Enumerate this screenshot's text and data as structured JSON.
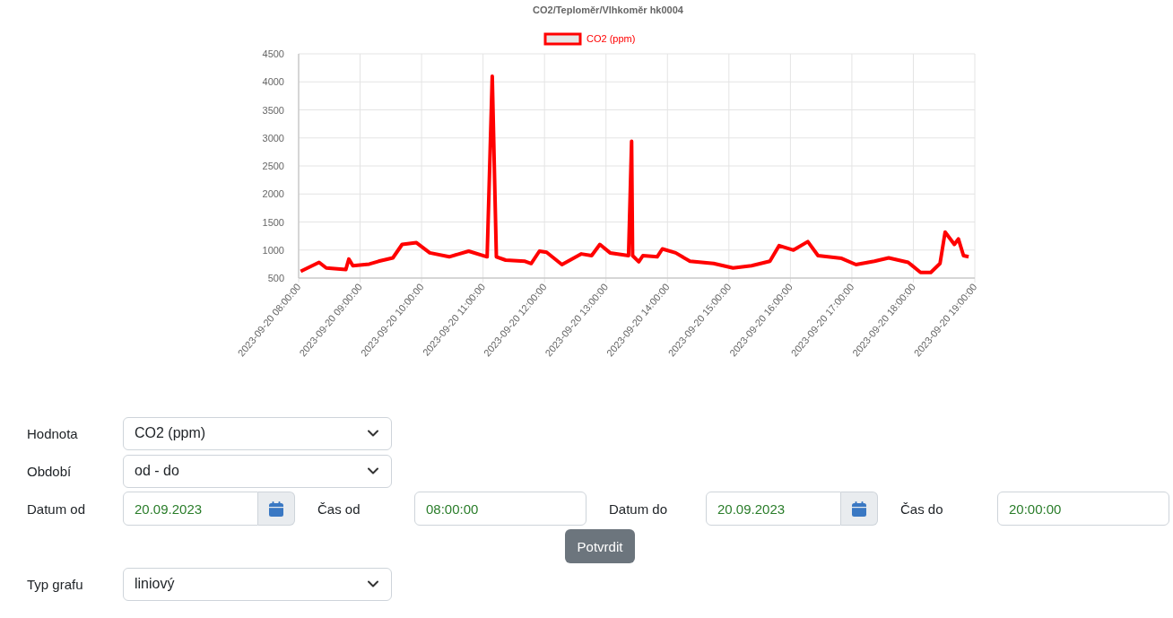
{
  "chart": {
    "chart_data": {
      "type": "line",
      "title": "CO2/Teploměr/Vlhkoměr hk0004",
      "x": [
        "2023-09-20 08:02:00",
        "2023-09-20 08:20:00",
        "2023-09-20 08:27:00",
        "2023-09-20 08:46:00",
        "2023-09-20 08:49:00",
        "2023-09-20 08:53:00",
        "2023-09-20 09:09:00",
        "2023-09-20 09:18:00",
        "2023-09-20 09:32:00",
        "2023-09-20 09:41:00",
        "2023-09-20 09:55:00",
        "2023-09-20 10:08:00",
        "2023-09-20 10:27:00",
        "2023-09-20 10:46:00",
        "2023-09-20 11:04:00",
        "2023-09-20 11:09:00",
        "2023-09-20 11:13:00",
        "2023-09-20 11:22:00",
        "2023-09-20 11:41:00",
        "2023-09-20 11:47:00",
        "2023-09-20 11:55:00",
        "2023-09-20 12:02:00",
        "2023-09-20 12:17:00",
        "2023-09-20 12:36:00",
        "2023-09-20 12:46:00",
        "2023-09-20 12:54:00",
        "2023-09-20 13:04:00",
        "2023-09-20 13:22:00",
        "2023-09-20 13:25:00",
        "2023-09-20 13:26:00",
        "2023-09-20 13:32:00",
        "2023-09-20 13:36:00",
        "2023-09-20 13:50:00",
        "2023-09-20 13:55:00",
        "2023-09-20 14:08:00",
        "2023-09-20 14:22:00",
        "2023-09-20 14:45:00",
        "2023-09-20 15:04:00",
        "2023-09-20 15:22:00",
        "2023-09-20 15:40:00",
        "2023-09-20 15:49:00",
        "2023-09-20 16:03:00",
        "2023-09-20 16:17:00",
        "2023-09-20 16:27:00",
        "2023-09-20 16:50:00",
        "2023-09-20 17:04:00",
        "2023-09-20 17:22:00",
        "2023-09-20 17:36:00",
        "2023-09-20 17:55:00",
        "2023-09-20 18:07:00",
        "2023-09-20 18:17:00",
        "2023-09-20 18:26:00",
        "2023-09-20 18:31:00",
        "2023-09-20 18:40:00",
        "2023-09-20 18:44:00",
        "2023-09-20 18:49:00",
        "2023-09-20 18:54:00"
      ],
      "series": [
        {
          "name": "CO2 (ppm)",
          "color": "#ff0000",
          "values": [
            620,
            780,
            680,
            650,
            840,
            720,
            750,
            800,
            860,
            1100,
            1130,
            950,
            880,
            980,
            880,
            4100,
            880,
            820,
            800,
            760,
            980,
            960,
            740,
            930,
            900,
            1100,
            950,
            900,
            2940,
            900,
            790,
            900,
            880,
            1020,
            950,
            800,
            760,
            680,
            720,
            800,
            1080,
            1000,
            1150,
            900,
            850,
            740,
            800,
            860,
            780,
            600,
            600,
            760,
            1320,
            1100,
            1200,
            900,
            880
          ]
        }
      ],
      "xlim": [
        "2023-09-20 08:00:00",
        "2023-09-20 19:00:00"
      ],
      "ylim": [
        500,
        4500
      ],
      "grid": true,
      "xticks": [
        "2023-09-20 08:00:00",
        "2023-09-20 09:00:00",
        "2023-09-20 10:00:00",
        "2023-09-20 11:00:00",
        "2023-09-20 12:00:00",
        "2023-09-20 13:00:00",
        "2023-09-20 14:00:00",
        "2023-09-20 15:00:00",
        "2023-09-20 16:00:00",
        "2023-09-20 17:00:00",
        "2023-09-20 18:00:00",
        "2023-09-20 19:00:00"
      ],
      "yticks": [
        500,
        1000,
        1500,
        2000,
        2500,
        3000,
        3500,
        4000,
        4500
      ]
    }
  },
  "value_select": {
    "label": "Hodnota",
    "value": "CO2 (ppm)"
  },
  "period_select": {
    "label": "Období",
    "value": "od - do"
  },
  "range": [
    {
      "kind": "date",
      "label": "Datum od",
      "value": "20.09.2023"
    },
    {
      "kind": "time",
      "label": "Čas od",
      "value": "08:00:00"
    },
    {
      "kind": "date",
      "label": "Datum do",
      "value": "20.09.2023"
    },
    {
      "kind": "time",
      "label": "Čas do",
      "value": "20:00:00"
    }
  ],
  "confirm_button": "Potvrdit",
  "chart_type_select": {
    "label": "Typ grafu",
    "value": "liniový"
  }
}
